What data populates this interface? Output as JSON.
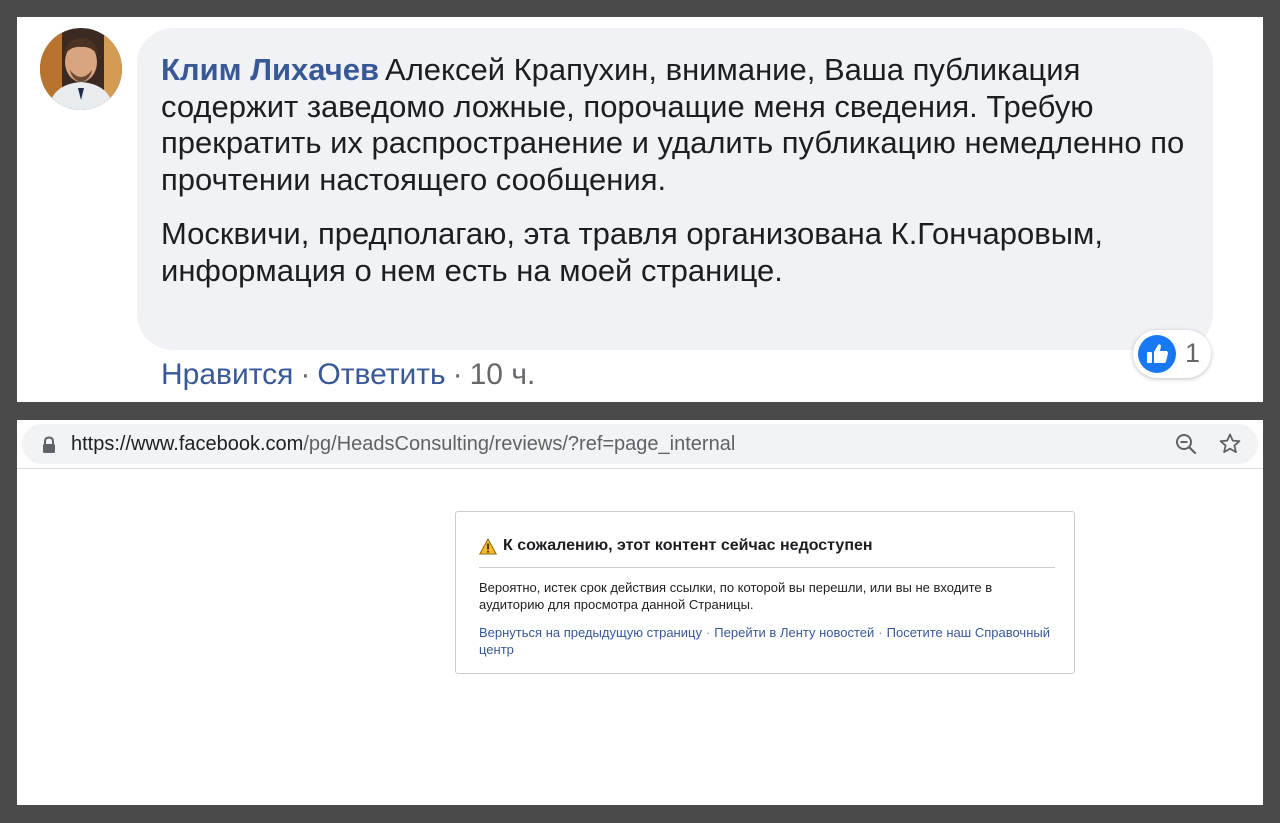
{
  "comment": {
    "author": "Клим Лихачев",
    "paragraph_1": "Алексей Крапухин, внимание, Ваша публикация содержит заведомо ложные, порочащие меня сведения. Требую прекратить их распространение и удалить публикацию немедленно по прочтении настоящего сообщения.",
    "paragraph_2": "Москвичи, предполагаю, эта травля организована К.Гончаровым, информация о нем есть на моей странице.",
    "reaction_icon": "like-icon",
    "reaction_count": "1",
    "like_label": "Нравится",
    "reply_label": "Ответить",
    "timestamp": "10 ч.",
    "separator": "·",
    "colors": {
      "author": "#385898",
      "bubble": "#f0f2f5",
      "like": "#1877f2"
    }
  },
  "browser": {
    "url_host": "https://www.facebook.com",
    "url_path": "/pg/HeadsConsulting/reviews/?ref=page_internal",
    "lock_icon": "lock-icon",
    "zoom_icon": "zoom-out-icon",
    "bookmark_icon": "star-icon"
  },
  "error": {
    "icon": "warning-icon",
    "title": "К сожалению, этот контент сейчас недоступен",
    "body": "Вероятно, истек срок действия ссылки, по которой вы перешли, или вы не входите в аудиторию для просмотра данной Страницы.",
    "link_back": "Вернуться на предыдущую страницу",
    "link_feed": "Перейти в Ленту новостей",
    "link_help": "Посетите наш Справочный центр",
    "separator": "·"
  }
}
